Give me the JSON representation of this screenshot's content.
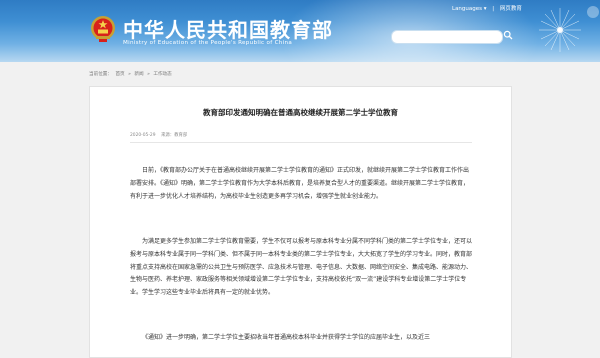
{
  "header": {
    "site_title": "中华人民共和国教育部",
    "site_subtitle": "Ministry of Education of the People's Republic of China",
    "languages": "Languages",
    "languages_arrow": "▾",
    "gov_link": "网页教育",
    "search_placeholder": ""
  },
  "breadcrumb": {
    "items": [
      "当前位置：",
      "首页",
      "»",
      "新闻",
      "»",
      "工作动态"
    ]
  },
  "article": {
    "title": "教育部印发通知明确在普通高校继续开展第二学士学位教育",
    "date": "2020-05-29",
    "source": "来源：教育部",
    "paragraphs": [
      "日前，《教育部办公厅关于在普通高校继续开展第二学士学位教育的通知》正式印发，就继续开展第二学士学位教育工作作出部署安排。《通知》明确，第二学士学位教育作为大学本科后教育，是培养复合型人才的重要渠道。继续开展第二学士学位教育，有利于进一步优化人才培养结构，为高校毕业生创造更多再学习机会，增强学生就业创业能力。",
      "为满足更多学生参加第二学士学位教育需要，学生不仅可以报考与原本科专业分属不同学科门类的第二学士学位专业，还可以报考与原本科专业属于同一学科门类、但不属于同一本科专业类的第二学士学位专业，大大拓宽了学生的学习专业。同时，教育部将重点支持高校在国家急需的公共卫生与预防医学、应急技术与管理、电子信息、大数据、网络空间安全、集成电路、能源动力、生物与医药、养老护理、家政服务等相关领域增设第二学士学位专业，支持高校依托“双一流”建设学科专业增设第二学士学位专业。学生学习这些专业毕业后将具有一定的就业优势。",
      "《通知》进一步明确，第二学士学位主要招收当年普通高校本科毕业并获得学士学位的应届毕业生，以及近三"
    ]
  }
}
